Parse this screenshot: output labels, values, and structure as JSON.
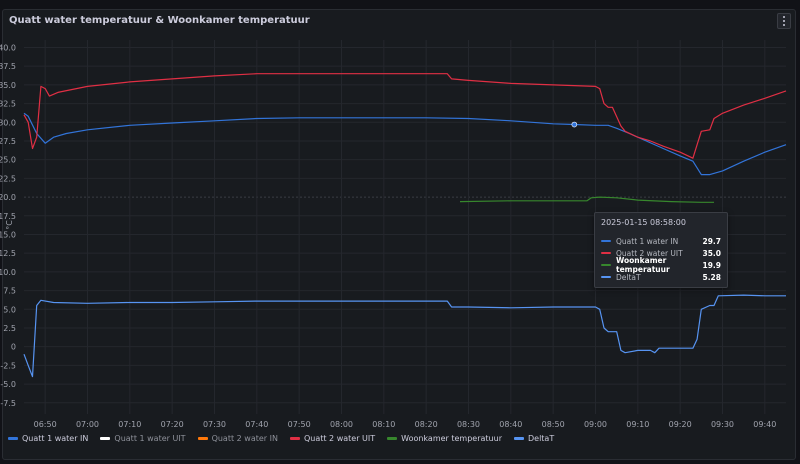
{
  "panel": {
    "title": "Quatt water temperatuur & Woonkamer temperatuur",
    "menu_icon": "vertical-dots-icon"
  },
  "chart_data": {
    "type": "line",
    "ylabel": "°C",
    "ylim": [
      -9,
      41
    ],
    "yticks": [
      40,
      35,
      30,
      25,
      20,
      15,
      10,
      5,
      0,
      -5
    ],
    "ytick_labels": [
      "40.0",
      "37.5",
      "35.0",
      "32.5",
      "30.0",
      "27.5",
      "25.0",
      "22.5",
      "20.0",
      "17.5",
      "15.0",
      "12.5",
      "10.0",
      "7.5",
      "5.0",
      "2.5",
      "0",
      "-2.5",
      "-5.0",
      "-7.5"
    ],
    "ytick_label_values": [
      40,
      37.5,
      35,
      32.5,
      30,
      27.5,
      25,
      22.5,
      20,
      17.5,
      15,
      12.5,
      10,
      7.5,
      5,
      2.5,
      0,
      -2.5,
      -5,
      -7.5
    ],
    "xlim_minutes": [
      405,
      585
    ],
    "xtick_labels": [
      "06:50",
      "07:00",
      "07:10",
      "07:20",
      "07:30",
      "07:40",
      "07:50",
      "08:00",
      "08:10",
      "08:20",
      "08:30",
      "08:40",
      "08:50",
      "09:00",
      "09:10",
      "09:20",
      "09:30",
      "09:40"
    ],
    "xtick_minutes": [
      410,
      420,
      430,
      440,
      450,
      460,
      470,
      480,
      490,
      500,
      510,
      520,
      530,
      540,
      550,
      560,
      570,
      580
    ],
    "series": [
      {
        "name": "Quatt 1 water IN",
        "color": "#3274d9",
        "points": [
          [
            405,
            31.2
          ],
          [
            406,
            30.8
          ],
          [
            408,
            28.5
          ],
          [
            410,
            27.2
          ],
          [
            412,
            28.0
          ],
          [
            415,
            28.5
          ],
          [
            420,
            29.0
          ],
          [
            430,
            29.6
          ],
          [
            440,
            29.9
          ],
          [
            450,
            30.2
          ],
          [
            460,
            30.5
          ],
          [
            470,
            30.6
          ],
          [
            480,
            30.6
          ],
          [
            490,
            30.6
          ],
          [
            500,
            30.6
          ],
          [
            510,
            30.5
          ],
          [
            520,
            30.2
          ],
          [
            530,
            29.8
          ],
          [
            535,
            29.7
          ],
          [
            540,
            29.6
          ],
          [
            543,
            29.6
          ],
          [
            545,
            29.2
          ],
          [
            548,
            28.5
          ],
          [
            552,
            27.5
          ],
          [
            556,
            26.5
          ],
          [
            560,
            25.5
          ],
          [
            563,
            24.8
          ],
          [
            565,
            23.0
          ],
          [
            567,
            23.0
          ],
          [
            570,
            23.5
          ],
          [
            575,
            24.8
          ],
          [
            580,
            26.0
          ],
          [
            585,
            27.0
          ]
        ]
      },
      {
        "name": "Quatt 1 water UIT",
        "color": "#ffffff",
        "points": []
      },
      {
        "name": "Quatt 2 water IN",
        "color": "#ff780a",
        "points": []
      },
      {
        "name": "Quatt 2 water UIT",
        "color": "#e02f44",
        "points": [
          [
            405,
            31.0
          ],
          [
            406,
            30.0
          ],
          [
            407,
            26.5
          ],
          [
            408,
            28.0
          ],
          [
            409,
            34.8
          ],
          [
            410,
            34.5
          ],
          [
            411,
            33.5
          ],
          [
            413,
            34.0
          ],
          [
            420,
            34.8
          ],
          [
            430,
            35.4
          ],
          [
            440,
            35.8
          ],
          [
            450,
            36.2
          ],
          [
            460,
            36.5
          ],
          [
            470,
            36.5
          ],
          [
            480,
            36.5
          ],
          [
            490,
            36.5
          ],
          [
            500,
            36.5
          ],
          [
            505,
            36.5
          ],
          [
            506,
            35.8
          ],
          [
            510,
            35.6
          ],
          [
            520,
            35.2
          ],
          [
            530,
            35.0
          ],
          [
            540,
            34.8
          ],
          [
            541,
            34.5
          ],
          [
            542,
            32.5
          ],
          [
            543,
            32.0
          ],
          [
            544,
            32.0
          ],
          [
            546,
            29.5
          ],
          [
            547,
            28.8
          ],
          [
            550,
            28.0
          ],
          [
            553,
            27.5
          ],
          [
            556,
            26.8
          ],
          [
            560,
            26.0
          ],
          [
            563,
            25.2
          ],
          [
            564,
            27.0
          ],
          [
            565,
            28.8
          ],
          [
            567,
            29.0
          ],
          [
            568,
            30.5
          ],
          [
            570,
            31.2
          ],
          [
            575,
            32.3
          ],
          [
            580,
            33.2
          ],
          [
            585,
            34.2
          ]
        ]
      },
      {
        "name": "Woonkamer temperatuur",
        "color": "#37872d",
        "points": [
          [
            508,
            19.4
          ],
          [
            520,
            19.5
          ],
          [
            530,
            19.5
          ],
          [
            535,
            19.5
          ],
          [
            538,
            19.5
          ],
          [
            539,
            19.9
          ],
          [
            541,
            20.0
          ],
          [
            545,
            19.9
          ],
          [
            550,
            19.6
          ],
          [
            558,
            19.4
          ],
          [
            565,
            19.3
          ],
          [
            568,
            19.3
          ]
        ]
      },
      {
        "name": "DeltaT",
        "color": "#5794f2",
        "points": [
          [
            405,
            -1.0
          ],
          [
            406,
            -2.5
          ],
          [
            407,
            -4.0
          ],
          [
            408,
            5.5
          ],
          [
            409,
            6.2
          ],
          [
            412,
            5.9
          ],
          [
            420,
            5.8
          ],
          [
            430,
            5.9
          ],
          [
            440,
            5.9
          ],
          [
            450,
            6.0
          ],
          [
            460,
            6.1
          ],
          [
            470,
            6.1
          ],
          [
            480,
            6.1
          ],
          [
            490,
            6.1
          ],
          [
            500,
            6.1
          ],
          [
            505,
            6.1
          ],
          [
            506,
            5.3
          ],
          [
            510,
            5.3
          ],
          [
            520,
            5.2
          ],
          [
            530,
            5.3
          ],
          [
            540,
            5.3
          ],
          [
            541,
            5.0
          ],
          [
            542,
            2.5
          ],
          [
            543,
            2.0
          ],
          [
            545,
            2.0
          ],
          [
            546,
            -0.5
          ],
          [
            547,
            -0.8
          ],
          [
            550,
            -0.5
          ],
          [
            553,
            -0.5
          ],
          [
            554,
            -0.8
          ],
          [
            555,
            -0.2
          ],
          [
            560,
            -0.2
          ],
          [
            563,
            -0.2
          ],
          [
            564,
            1.0
          ],
          [
            565,
            5.0
          ],
          [
            567,
            5.5
          ],
          [
            568,
            5.5
          ],
          [
            569,
            6.8
          ],
          [
            575,
            6.9
          ],
          [
            580,
            6.8
          ],
          [
            585,
            6.8
          ]
        ]
      }
    ],
    "legend_placement": "bottom-left",
    "grid": true
  },
  "legend": {
    "items": [
      {
        "label": "Quatt 1 water IN",
        "color": "#3274d9",
        "dim": false
      },
      {
        "label": "Quatt 1 water UIT",
        "color": "#ffffff",
        "dim": true
      },
      {
        "label": "Quatt 2 water IN",
        "color": "#ff780a",
        "dim": true
      },
      {
        "label": "Quatt 2 water UIT",
        "color": "#e02f44",
        "dim": false
      },
      {
        "label": "Woonkamer temperatuur",
        "color": "#37872d",
        "dim": false
      },
      {
        "label": "DeltaT",
        "color": "#5794f2",
        "dim": false
      }
    ]
  },
  "tooltip": {
    "time": "2025-01-15 08:58:00",
    "rows": [
      {
        "name": "Quatt 1 water IN",
        "value": "29.7",
        "color": "#3274d9",
        "bold": false
      },
      {
        "name": "Quatt 2 water UIT",
        "value": "35.0",
        "color": "#e02f44",
        "bold": false
      },
      {
        "name": "Woonkamer temperatuur",
        "value": "19.9",
        "color": "#37872d",
        "bold": true
      },
      {
        "name": "DeltaT",
        "value": "5.28",
        "color": "#5794f2",
        "bold": false
      }
    ]
  }
}
